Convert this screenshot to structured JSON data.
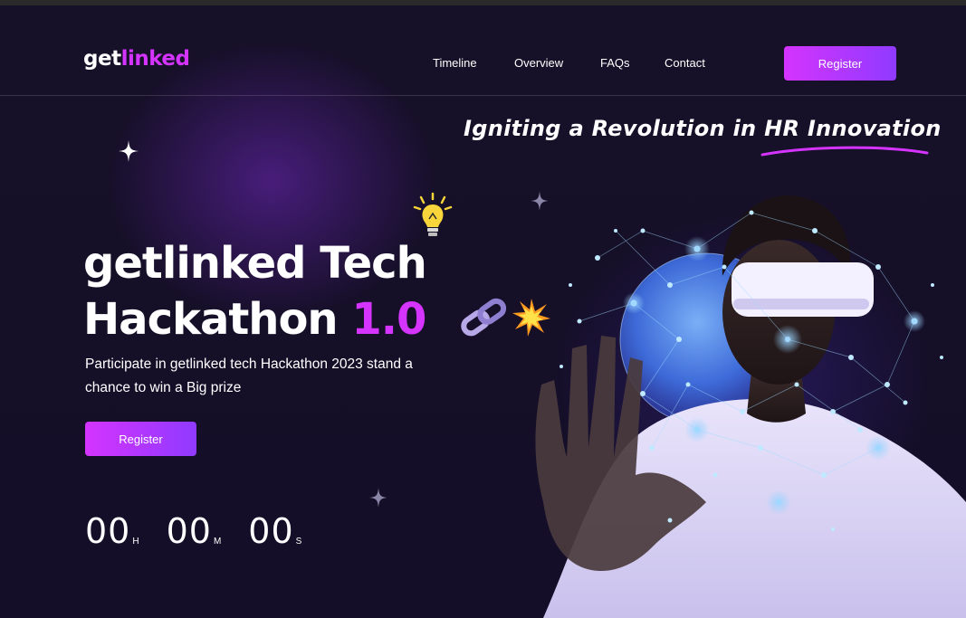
{
  "header": {
    "logo_part1": "get",
    "logo_part2": "linked",
    "nav": [
      "Timeline",
      "Overview",
      "FAQs",
      "Contact"
    ],
    "register_label": "Register"
  },
  "tagline": "Igniting a Revolution in HR Innovation",
  "hero": {
    "title_line1": "getlinked Tech",
    "title_line2": "Hackathon",
    "title_version": "1.0",
    "description": "Participate in getlinked tech Hackathon 2023 stand a chance to win a Big prize",
    "register_label": "Register"
  },
  "countdown": {
    "hours": "00",
    "hours_label": "H",
    "minutes": "00",
    "minutes_label": "M",
    "seconds": "00",
    "seconds_label": "S"
  },
  "colors": {
    "background": "#150e28",
    "accent": "#d434fe",
    "button_gradient_end": "#903aff"
  },
  "icons": [
    "sparkle-star-icon",
    "lightbulb-icon",
    "chain-link-icon",
    "spark-burst-icon"
  ]
}
